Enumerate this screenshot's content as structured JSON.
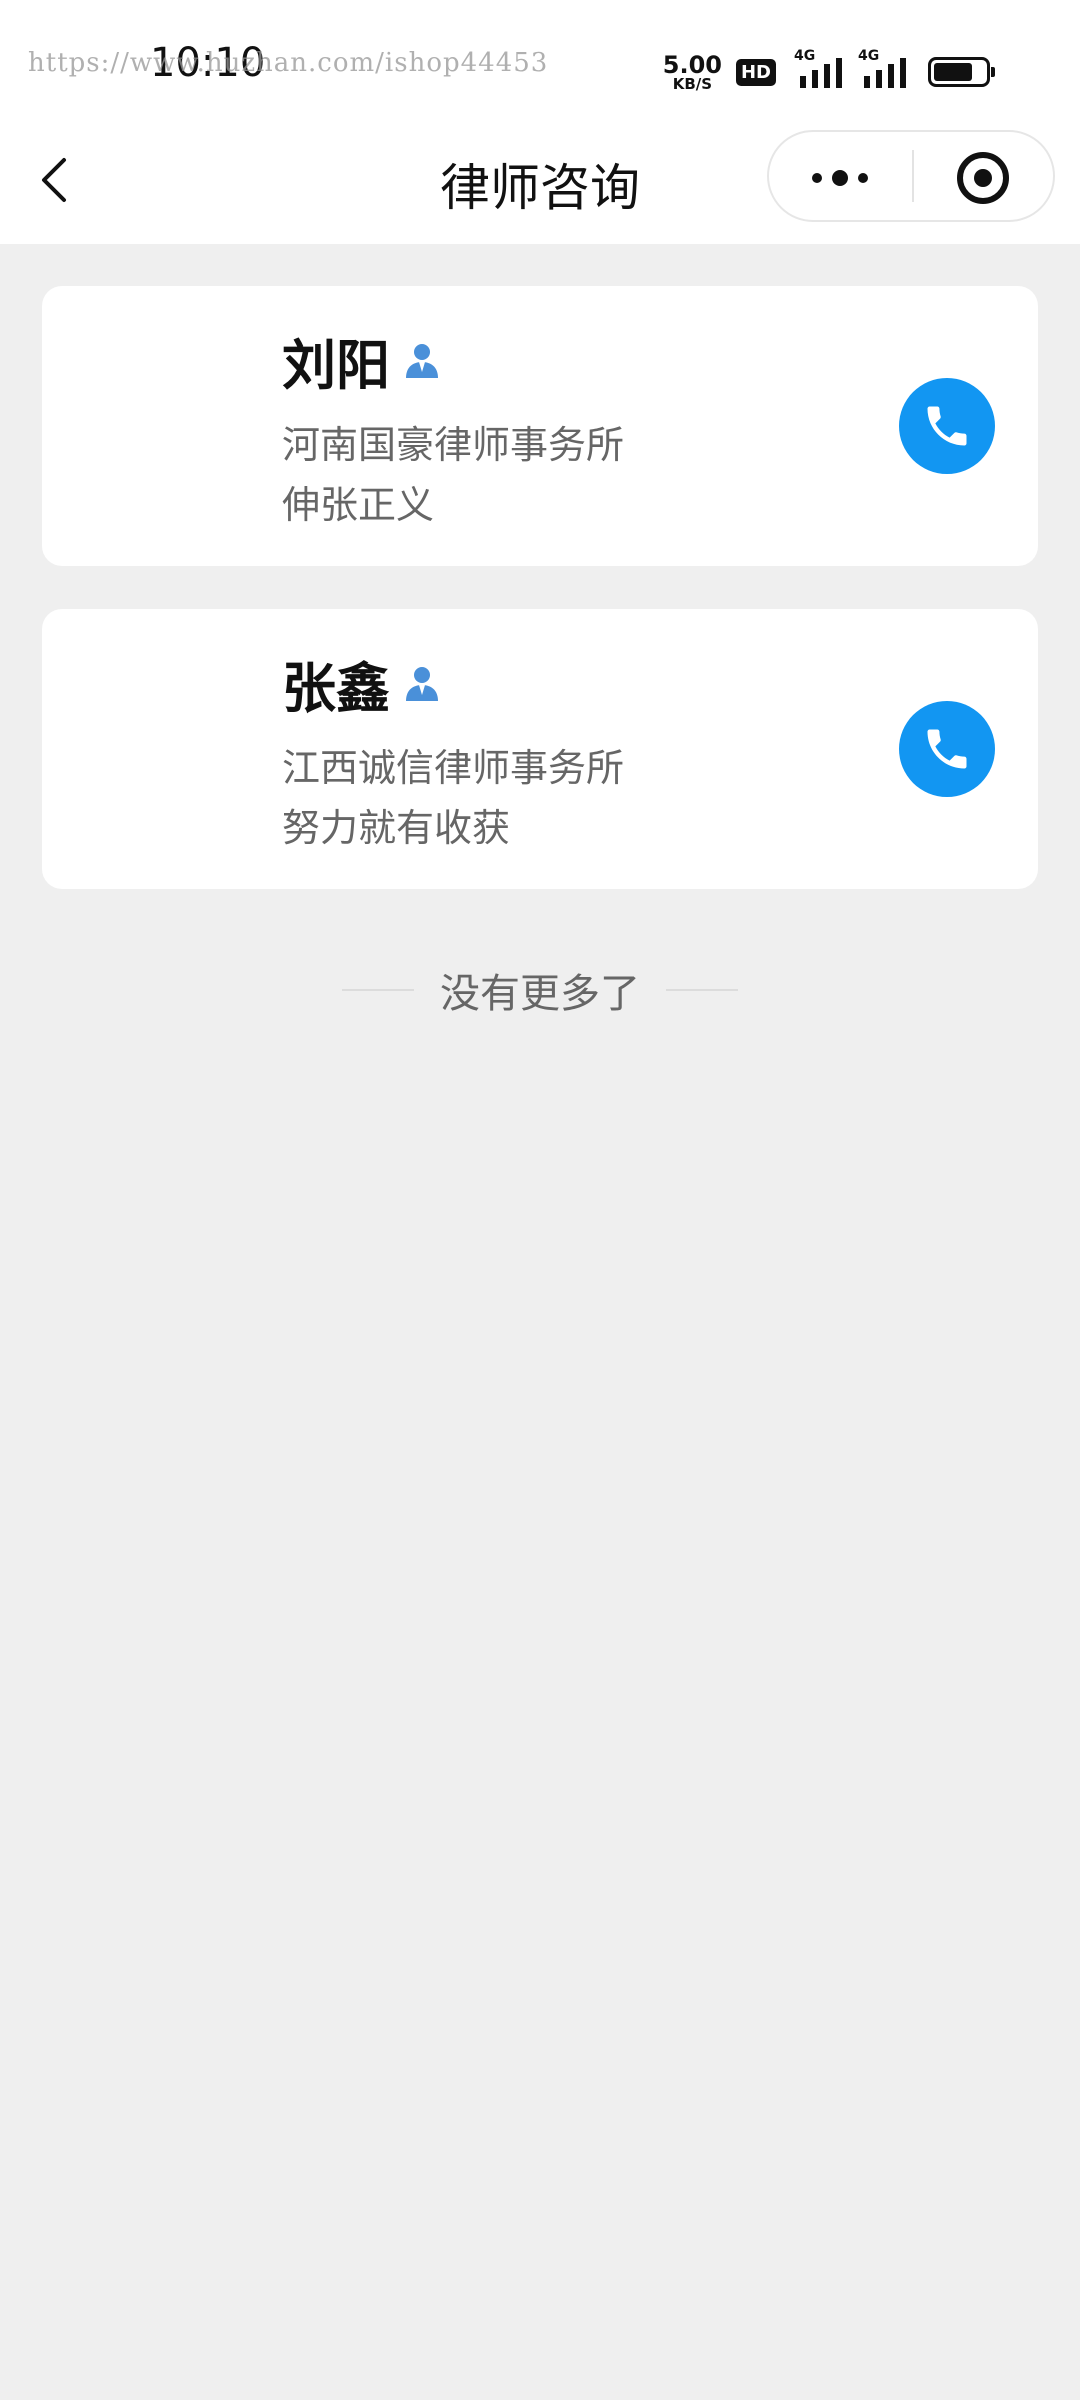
{
  "status_bar": {
    "time": "10:10",
    "watermark": "https://www.huzhan.com/ishop44453",
    "net_speed_value": "5.00",
    "net_speed_unit": "KB/S",
    "hd_badge": "HD",
    "signal_1_tag": "4G",
    "signal_2_tag": "4G",
    "battery_level": 0.75
  },
  "nav": {
    "title": "律师咨询",
    "back_icon": "chevron-left-icon",
    "more_icon": "more-dots-icon",
    "close_icon": "target-circle-icon"
  },
  "lawyers": [
    {
      "name": "刘阳",
      "firm": "河南国豪律师事务所",
      "motto": "伸张正义",
      "badge_icon": "lawyer-person-icon",
      "call_icon": "phone-icon"
    },
    {
      "name": "张鑫",
      "firm": "江西诚信律师事务所",
      "motto": "努力就有收获",
      "badge_icon": "lawyer-person-icon",
      "call_icon": "phone-icon"
    }
  ],
  "list_end_text": "没有更多了",
  "colors": {
    "page_background": "#efefef",
    "card_background": "#ffffff",
    "accent_blue": "#1296f2",
    "badge_blue": "#4a90d9",
    "secondary_text": "#666666"
  }
}
